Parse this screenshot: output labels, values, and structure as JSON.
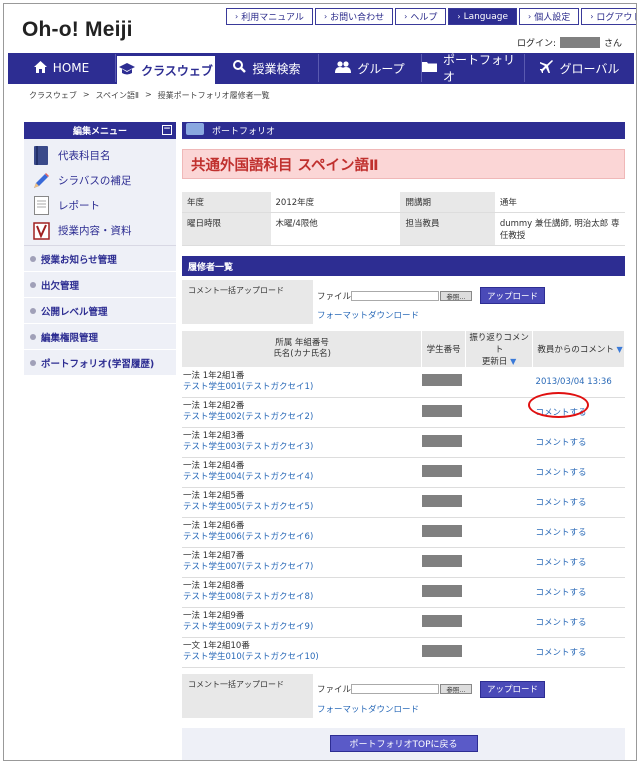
{
  "header": {
    "logo": "Oh-o! Meiji",
    "links": [
      {
        "label": "利用マニュアル",
        "dark": false
      },
      {
        "label": "お問い合わせ",
        "dark": false
      },
      {
        "label": "ヘルプ",
        "dark": false
      },
      {
        "label": "Language",
        "dark": true
      },
      {
        "label": "個人設定",
        "dark": false
      },
      {
        "label": "ログアウト",
        "dark": false
      }
    ],
    "login_label": "ログイン:",
    "login_suffix": "さん"
  },
  "nav": [
    {
      "label": "HOME",
      "icon": "home-icon"
    },
    {
      "label": "クラスウェブ",
      "icon": "mortarboard-icon"
    },
    {
      "label": "授業検索",
      "icon": "search-icon"
    },
    {
      "label": "グループ",
      "icon": "group-icon"
    },
    {
      "label": "ポートフォリオ",
      "icon": "folder-icon"
    },
    {
      "label": "グローバル",
      "icon": "airplane-icon"
    }
  ],
  "breadcrumb": [
    "クラスウェブ",
    ">",
    "スペイン語Ⅱ",
    ">",
    "授業ポートフォリオ履修者一覧"
  ],
  "sidebar": {
    "title": "編集メニュー",
    "toggle": "−",
    "main_items": [
      {
        "label": "代表科目名",
        "icon": "book-icon"
      },
      {
        "label": "シラバスの補足",
        "icon": "pencil-icon"
      },
      {
        "label": "レポート",
        "icon": "document-icon"
      },
      {
        "label": "授業内容・資料",
        "icon": "binder-icon"
      }
    ],
    "sub_items": [
      "授業お知らせ管理",
      "出欠管理",
      "公開レベル管理",
      "編集権限管理",
      "ポートフォリオ(学習履歴)"
    ]
  },
  "main": {
    "section_label": "ポートフォリオ",
    "course_title": "共通外国語科目 スペイン語Ⅱ",
    "info": {
      "year_label": "年度",
      "year": "2012年度",
      "term_label": "開講期",
      "term": "通年",
      "time_label": "曜日時限",
      "time": "木曜/4限他",
      "teacher_label": "担当教員",
      "teacher": "dummy 兼任講師, 明治太郎 専任教授"
    },
    "roster_title": "履修者一覧",
    "upload": {
      "label": "コメント一括アップロード",
      "file_label": "ファイル",
      "browse_label": "参照...",
      "upload_button": "アップロード",
      "format_link": "フォーマットダウンロード"
    },
    "columns": {
      "c1a": "所属 年組番号",
      "c1b": "氏名(カナ氏名)",
      "c2": "学生番号",
      "c3a": "振り返りコメント",
      "c3b": "更新日",
      "c4": "教員からのコメント"
    },
    "students": [
      {
        "cls": "一法 1年2組1番",
        "name": "テスト学生001(テストガクセイ1)",
        "comment": "2013/03/04 13:36"
      },
      {
        "cls": "一法 1年2組2番",
        "name": "テスト学生002(テストガクセイ2)",
        "comment": "コメントする"
      },
      {
        "cls": "一法 1年2組3番",
        "name": "テスト学生003(テストガクセイ3)",
        "comment": "コメントする"
      },
      {
        "cls": "一法 1年2組4番",
        "name": "テスト学生004(テストガクセイ4)",
        "comment": "コメントする"
      },
      {
        "cls": "一法 1年2組5番",
        "name": "テスト学生005(テストガクセイ5)",
        "comment": "コメントする"
      },
      {
        "cls": "一法 1年2組6番",
        "name": "テスト学生006(テストガクセイ6)",
        "comment": "コメントする"
      },
      {
        "cls": "一法 1年2組7番",
        "name": "テスト学生007(テストガクセイ7)",
        "comment": "コメントする"
      },
      {
        "cls": "一法 1年2組8番",
        "name": "テスト学生008(テストガクセイ8)",
        "comment": "コメントする"
      },
      {
        "cls": "一法 1年2組9番",
        "name": "テスト学生009(テストガクセイ9)",
        "comment": "コメントする"
      },
      {
        "cls": "一文 1年2組10番",
        "name": "テスト学生010(テストガクセイ10)",
        "comment": "コメントする"
      }
    ],
    "back_button": "ポートフォリオTOPに戻る"
  },
  "colors": {
    "brand": "#2d2d92",
    "title_bg": "#fbd6d6",
    "title_text": "#c0302e",
    "link": "#2a6ab8",
    "highlight": "#e01010"
  }
}
